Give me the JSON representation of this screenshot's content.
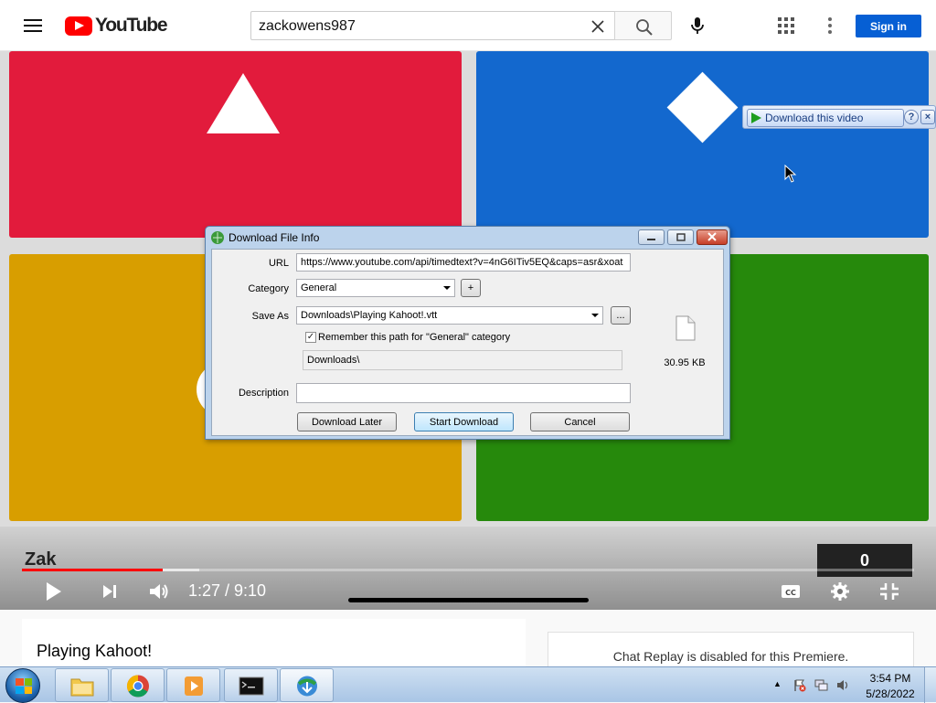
{
  "youtube": {
    "logo_text": "YouTube",
    "search_value": "zackowens987",
    "signin_label": "Sign in"
  },
  "video": {
    "player_name": "Zak",
    "score": "0",
    "time_display": "1:27 / 9:10",
    "progress_fraction": 0.158,
    "buffer_fraction": 0.199,
    "download_overlay_label": "Download this video",
    "download_overlay_help": "?",
    "download_overlay_close": "×",
    "tile_colors": {
      "red": "#e21b3c",
      "blue": "#1368ce",
      "yellow": "#d89e00",
      "green": "#26890c"
    }
  },
  "dialog": {
    "title": "Download File Info",
    "url_label": "URL",
    "url_value": "https://www.youtube.com/api/timedtext?v=4nG6ITiv5EQ&caps=asr&xoat",
    "category_label": "Category",
    "category_value": "General",
    "add_category_label": "+",
    "save_as_label": "Save As",
    "save_as_value": "Downloads\\Playing Kahoot!.vtt",
    "browse_label": "...",
    "remember_label": "Remember this path for \"General\" category",
    "remember_checked": true,
    "path_display": "Downloads\\",
    "description_label": "Description",
    "description_value": "",
    "file_size": "30.95 KB",
    "buttons": {
      "download_later": "Download Later",
      "start_download": "Start Download",
      "cancel": "Cancel"
    }
  },
  "page": {
    "video_title": "Playing Kahoot!",
    "chat_replay_text": "Chat Replay is disabled for this Premiere."
  },
  "taskbar": {
    "time": "3:54 PM",
    "date": "5/28/2022",
    "tray_expand": "▲"
  }
}
